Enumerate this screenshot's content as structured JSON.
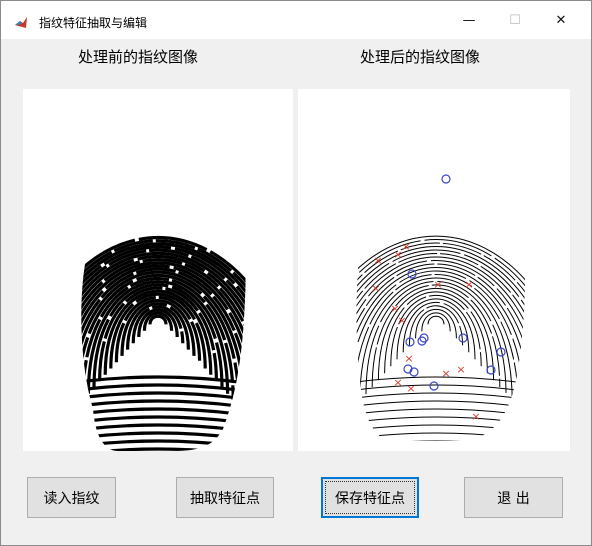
{
  "window": {
    "title": "指纹特征抽取与编辑",
    "minimize_glyph": "—",
    "maximize_glyph": "☐",
    "close_glyph": "✕"
  },
  "left_panel": {
    "label": "处理前的指纹图像"
  },
  "right_panel": {
    "label": "处理后的指纹图像"
  },
  "buttons": {
    "load": "读入指纹",
    "extract": "抽取特征点",
    "save": "保存特征点",
    "exit": "退 出"
  },
  "colors": {
    "ridge_dark": "#000000",
    "minutia_cross": "#e03a2a",
    "minutia_circle": "#3a46c8",
    "focus_border": "#0078d7"
  },
  "icons": {
    "app": "matlab-icon",
    "minimize": "minimize-icon",
    "maximize": "maximize-icon",
    "close": "close-icon"
  }
}
